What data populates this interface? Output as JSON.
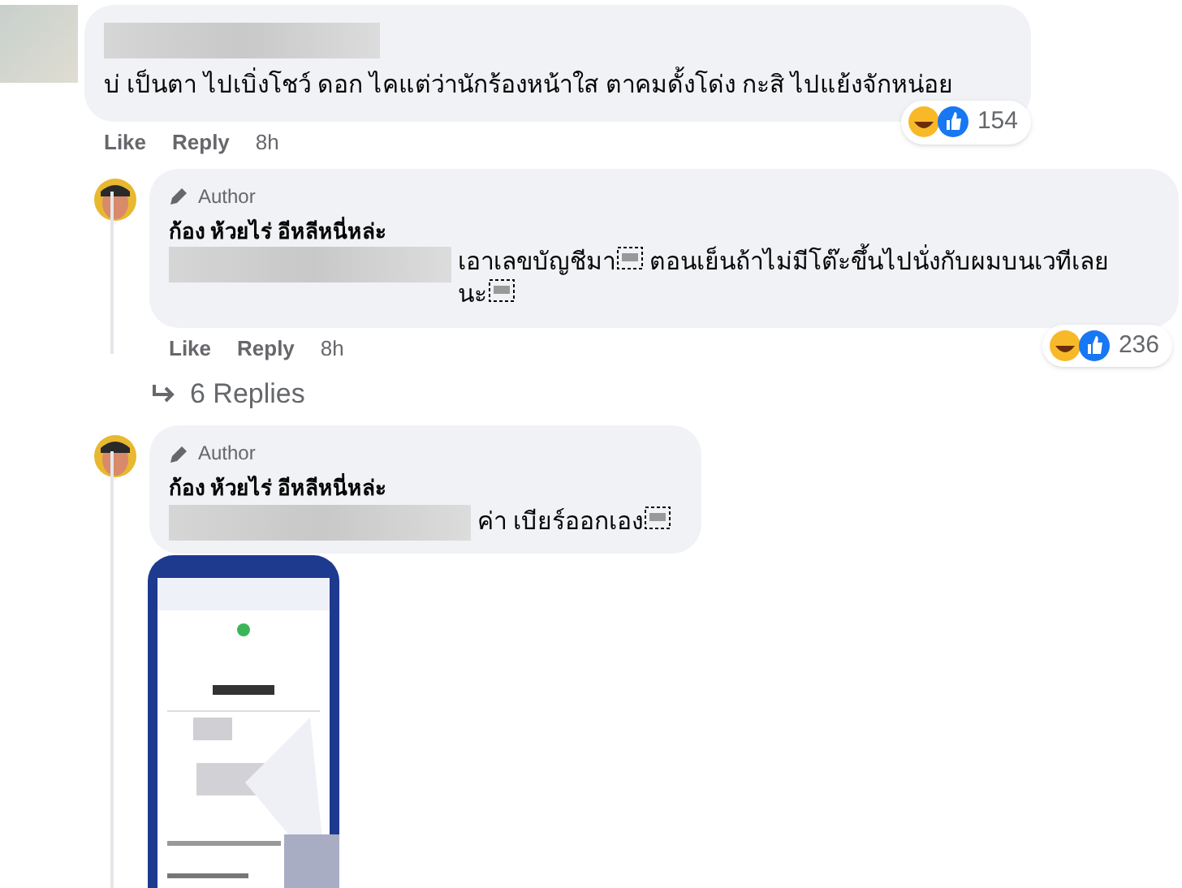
{
  "comments": [
    {
      "text_segments": [
        "บ่ เป็นตา ไปเบิ่งโชว์ ดอก ไคแต่ว่านักร้องหน้าใส ตาคมดั้งโด่ง กะสิ ไปแย้งจักหน่อย"
      ],
      "actions": [
        "Like",
        "Reply"
      ],
      "time": "8h",
      "reaction_count": "154"
    },
    {
      "author_badge": "Author",
      "name": "ก้อง ห้วยไร่ อีหลีหนี่หล่ะ",
      "text_segments": [
        {
          "text": "เอาเลขบัญชีมา",
          "object_icon": true
        },
        {
          "text": " ตอนเย็นถ้าไม่มีโต๊ะขึ้นไปนั่งกับผมบนเวทีเลยนะ",
          "object_icon": true
        }
      ],
      "actions": [
        "Like",
        "Reply"
      ],
      "time": "8h",
      "reaction_count": "236",
      "replies_link": "6 Replies"
    },
    {
      "author_badge": "Author",
      "name": "ก้อง ห้วยไร่ อีหลีหนี่หล่ะ",
      "text_segments": [
        {
          "text": "ค่า เบียร์ออกเอง",
          "object_icon": true
        }
      ],
      "attachment": {
        "kind": "picture"
      }
    }
  ]
}
